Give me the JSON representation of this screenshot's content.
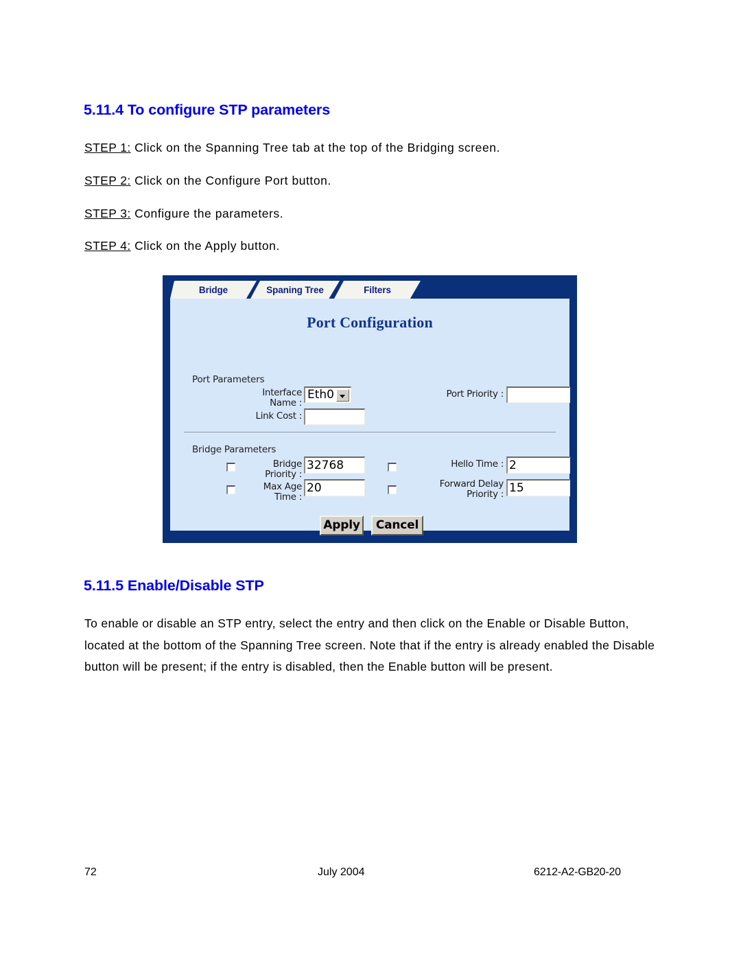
{
  "headings": {
    "section_1": "5.11.4 To configure STP parameters",
    "section_2": "5.11.5 Enable/Disable STP"
  },
  "steps": [
    {
      "label": "STEP 1:",
      "text": " Click on the Spanning Tree tab at the top of the Bridging screen."
    },
    {
      "label": "STEP 2:",
      "text": " Click on the Configure Port button."
    },
    {
      "label": "STEP 3:",
      "text": " Configure the parameters."
    },
    {
      "label": "STEP 4:",
      "text": " Click on the Apply button."
    }
  ],
  "paragraph": "To enable or disable an STP entry, select the entry and then click on the Enable or Disable Button, located at the bottom of the Spanning Tree screen. Note that if the entry is already enabled the Disable button will be present; if the entry is disabled, then the Enable button will be present.",
  "footer": {
    "page_number": "72",
    "date": "July 2004",
    "document_code": "6212-A2-GB20-20"
  },
  "screenshot": {
    "tabs": [
      {
        "label": "Bridge",
        "selected": false
      },
      {
        "label": "Spaning Tree",
        "selected": true
      },
      {
        "label": "Filters",
        "selected": false
      }
    ],
    "panel_title": "Port Configuration",
    "port_parameters": {
      "group_label": "Port Parameters",
      "interface_name_label": "Interface\nName :",
      "interface_name_value": "Eth0",
      "link_cost_label": "Link Cost :",
      "link_cost_value": "",
      "port_priority_label": "Port Priority :",
      "port_priority_value": ""
    },
    "bridge_parameters": {
      "group_label": "Bridge Parameters",
      "bridge_priority_label": "Bridge\nPriority :",
      "bridge_priority_value": "32768",
      "max_age_time_label": "Max Age\nTime :",
      "max_age_time_value": "20",
      "hello_time_label": "Hello Time :",
      "hello_time_value": "2",
      "forward_delay_label": "Forward Delay\nPriority :",
      "forward_delay_value": "15"
    },
    "buttons": {
      "apply": "Apply",
      "cancel": "Cancel"
    },
    "colors": {
      "frame": "#0a3079",
      "panel": "#d7e7fa",
      "tab_text": "#10207a",
      "title": "#12358a"
    }
  }
}
